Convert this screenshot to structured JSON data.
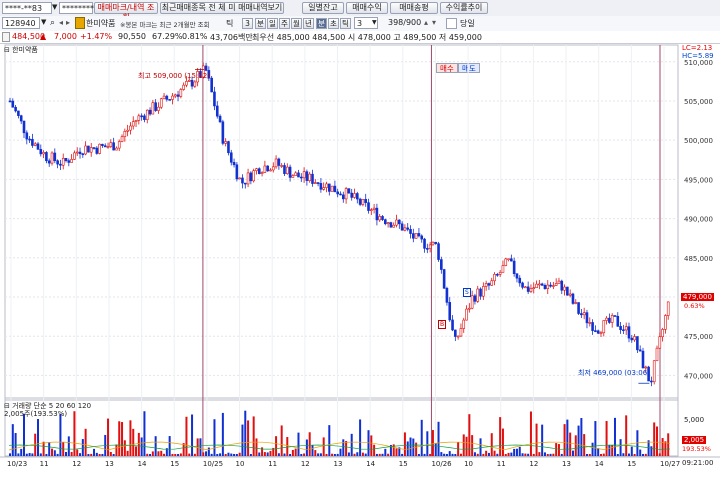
{
  "toolbar": {
    "account_id": "****-**83",
    "password_mask": "********",
    "tabs": [
      "매매마크/내역 조회",
      "최근매매종목 전 체 미 매매내역보기"
    ],
    "right_buttons": [
      "일별잔고",
      "매매수익",
      "매매송평",
      "수익률추이"
    ]
  },
  "row2": {
    "code": "128940",
    "stock_name": "한미약품",
    "notice": "※봉본 마크는 최근 2개월만 조회",
    "tick_label": "틱",
    "tick_value": "3",
    "period_buttons": [
      "분",
      "일",
      "주",
      "월",
      "년"
    ],
    "period_active": "분",
    "period_value": "3",
    "period2": [
      "분",
      "초",
      "틱"
    ],
    "count_value": "3",
    "range": "398/900",
    "single_label": "당일"
  },
  "quote": {
    "price": "484,500",
    "change_arrow": "▲",
    "change": "7,000",
    "change_pct": "+1.47%",
    "volume": "90,550",
    "ratio": "67.29%",
    "rate": "0.81%",
    "amount": "43,706백만",
    "summary": "최우선 485,000 484,500 시 478,000 고 489,500 저 459,000",
    "buy_label": "매수",
    "sell_label": "매도"
  },
  "chart_title": "한미약품",
  "price_axis_top": "LC=2.13",
  "price_axis_hc": "HC=5.89",
  "annotations": {
    "high": "최고 509,000 (15:12)",
    "low": "최저 469,000 (03:06)",
    "marker_b": "B",
    "marker_s": "S"
  },
  "current_price_label": "479,000",
  "current_change_label": "0.63%",
  "volume_panel": {
    "title": "거래량 단순 5 20 60 120",
    "value": "2,005주(193.53%)",
    "axis_label": "5,000",
    "right_label_1": "2,005",
    "right_label_2": "193.53%"
  },
  "x_ticks": [
    "10/23",
    "11",
    "12",
    "13",
    "14",
    "15",
    "10/25",
    "10",
    "11",
    "12",
    "13",
    "14",
    "15",
    "10/26",
    "10",
    "11",
    "12",
    "13",
    "14",
    "15",
    "10/27"
  ],
  "time_label": "09:21:00",
  "chart_data": {
    "type": "candlestick",
    "y_ticks": [
      510000,
      505000,
      500000,
      495000,
      490000,
      485000,
      480000,
      475000,
      470000
    ],
    "ylim": [
      467500,
      511500
    ],
    "volume_ticks": [
      "5,000"
    ],
    "high_marker": {
      "value": 509000,
      "label": "최고 509,000 (15:12)"
    },
    "low_marker": {
      "value": 469000,
      "label": "최저 469,000 (03:06)"
    },
    "session_dividers": [
      "10/25",
      "10/26",
      "10/27"
    ],
    "approx_price_path": [
      505000,
      500500,
      498000,
      497000,
      499000,
      499000,
      499500,
      502500,
      504000,
      505500,
      507000,
      509000,
      500000,
      494500,
      496500,
      497000,
      495500,
      495000,
      494000,
      493000,
      491500,
      490000,
      489000,
      487000,
      486500,
      474000,
      480000,
      481500,
      484500,
      481000,
      481500,
      481500,
      478000,
      476000,
      477000,
      475000,
      469000,
      479000
    ]
  }
}
